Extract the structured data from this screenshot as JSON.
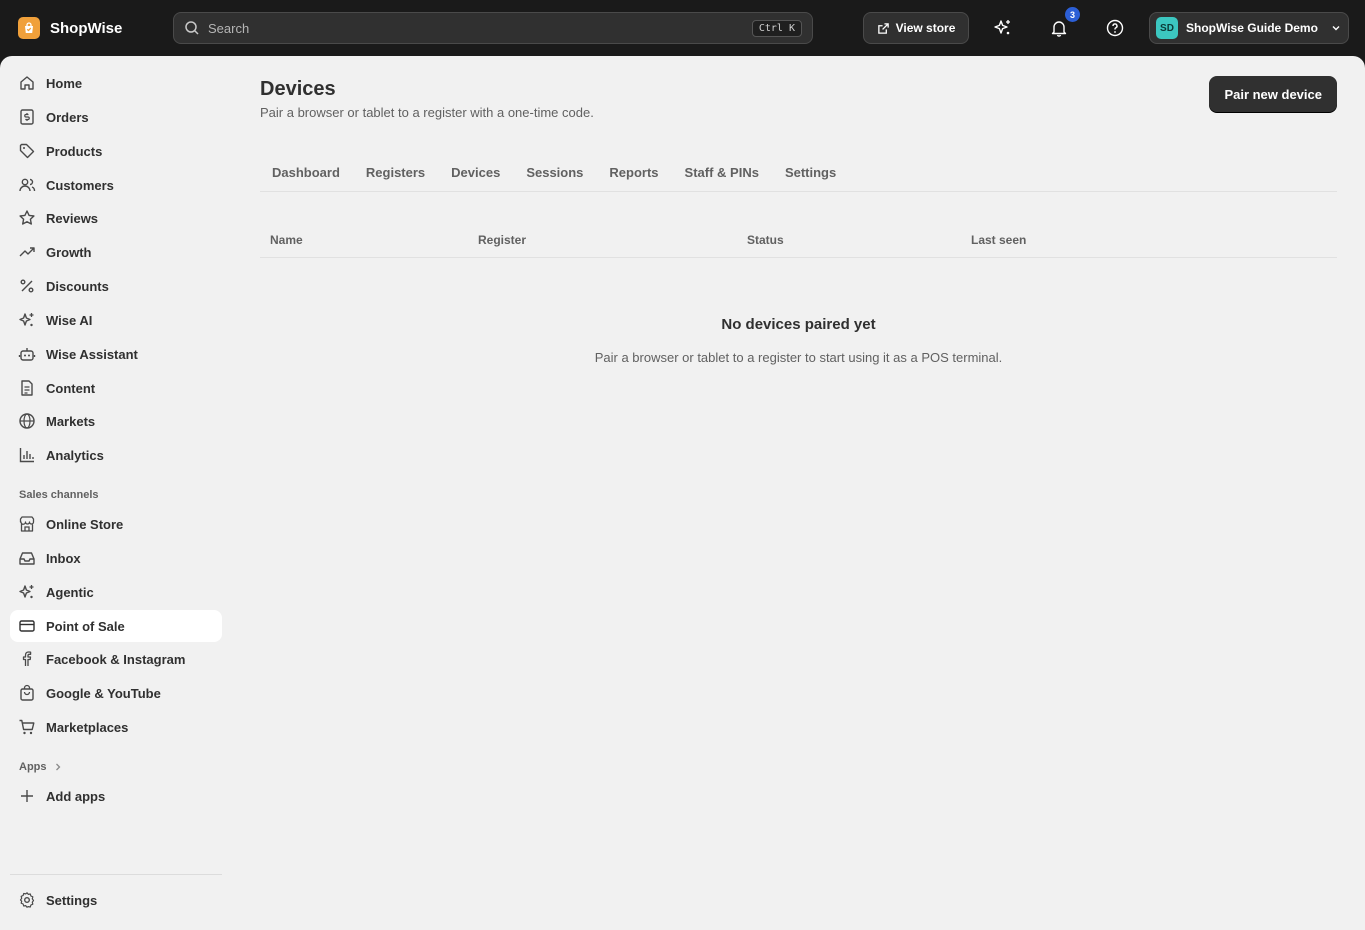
{
  "app": {
    "name": "ShopWise"
  },
  "search": {
    "placeholder": "Search",
    "shortcut": "Ctrl K"
  },
  "topbar": {
    "view_store": "View store",
    "notifications_count": "3",
    "account_initials": "SD",
    "account_name": "ShopWise Guide Demo"
  },
  "sidebar": {
    "main_items": [
      {
        "label": "Home",
        "icon": "home-icon"
      },
      {
        "label": "Orders",
        "icon": "orders-icon"
      },
      {
        "label": "Products",
        "icon": "tag-icon"
      },
      {
        "label": "Customers",
        "icon": "users-icon"
      },
      {
        "label": "Reviews",
        "icon": "star-icon"
      },
      {
        "label": "Growth",
        "icon": "trending-up-icon"
      },
      {
        "label": "Discounts",
        "icon": "percent-icon"
      },
      {
        "label": "Wise AI",
        "icon": "sparkles-icon"
      },
      {
        "label": "Wise Assistant",
        "icon": "bot-icon"
      },
      {
        "label": "Content",
        "icon": "document-icon"
      },
      {
        "label": "Markets",
        "icon": "globe-icon"
      },
      {
        "label": "Analytics",
        "icon": "bar-chart-icon"
      }
    ],
    "sales_channels_label": "Sales channels",
    "channel_items": [
      {
        "label": "Online Store",
        "icon": "storefront-icon"
      },
      {
        "label": "Inbox",
        "icon": "inbox-icon"
      },
      {
        "label": "Agentic",
        "icon": "sparkles-icon"
      },
      {
        "label": "Point of Sale",
        "icon": "credit-card-icon",
        "active": true
      },
      {
        "label": "Facebook & Instagram",
        "icon": "facebook-icon"
      },
      {
        "label": "Google & YouTube",
        "icon": "shopping-bag-icon"
      },
      {
        "label": "Marketplaces",
        "icon": "cart-icon"
      }
    ],
    "apps_label": "Apps",
    "add_apps": "Add apps",
    "settings": "Settings"
  },
  "page": {
    "title": "Devices",
    "subtitle": "Pair a browser or tablet to a register with a one-time code.",
    "primary_action": "Pair new device",
    "tabs": [
      "Dashboard",
      "Registers",
      "Devices",
      "Sessions",
      "Reports",
      "Staff & PINs",
      "Settings"
    ],
    "active_tab": "Devices",
    "table_columns": [
      "Name",
      "Register",
      "Status",
      "Last seen"
    ],
    "empty_title": "No devices paired yet",
    "empty_description": "Pair a browser or tablet to a register to start using it as a POS terminal."
  }
}
